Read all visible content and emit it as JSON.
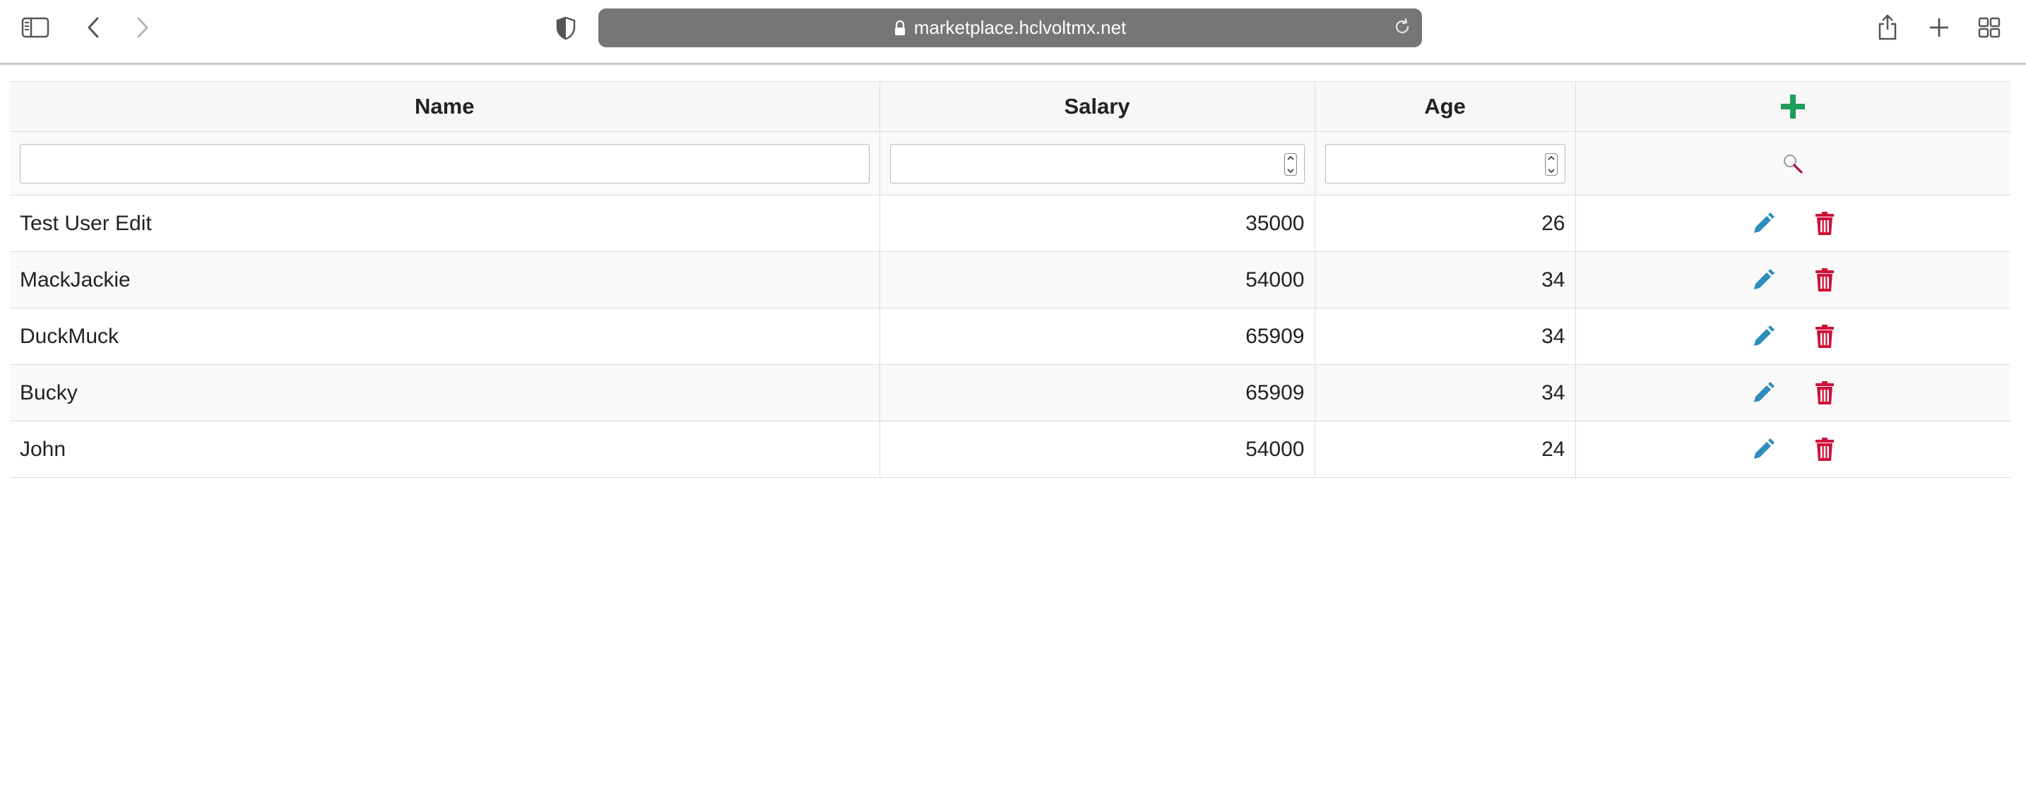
{
  "browser": {
    "url": "marketplace.hclvoltmx.net",
    "icons": [
      "sidebar-icon",
      "back-icon",
      "forward-icon",
      "shield-icon",
      "lock-icon",
      "reload-icon",
      "share-icon",
      "new-tab-icon",
      "tab-overview-icon"
    ]
  },
  "grid": {
    "columns": [
      "Name",
      "Salary",
      "Age"
    ],
    "add_icon": "plus-icon",
    "search_icon": "magnifier-icon",
    "rows": [
      {
        "name": "Test User Edit",
        "salary": "35000",
        "age": "26"
      },
      {
        "name": "MackJackie",
        "salary": "54000",
        "age": "34"
      },
      {
        "name": "DuckMuck",
        "salary": "65909",
        "age": "34"
      },
      {
        "name": "Bucky",
        "salary": "65909",
        "age": "34"
      },
      {
        "name": "John",
        "salary": "54000",
        "age": "24"
      }
    ]
  },
  "colors": {
    "add": "#1e9e5a",
    "edit": "#2f8dbd",
    "delete": "#d0103a",
    "url_bar": "#767676"
  }
}
